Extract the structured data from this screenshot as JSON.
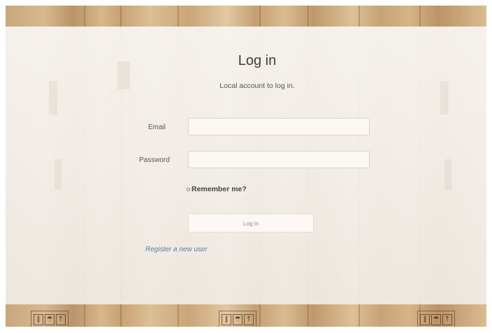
{
  "page": {
    "title": "Log in",
    "subtitle": "Local account to log in."
  },
  "form": {
    "email_label": "Email",
    "email_value": "",
    "password_label": "Password",
    "password_value": "",
    "remember_label": "Remember me?",
    "remember_checked": false,
    "submit_label": "Log in"
  },
  "links": {
    "register": "Register a new user"
  },
  "background": {
    "theme": "cardboard boxes",
    "handling_symbols": [
      "fragile-icon",
      "umbrella-icon",
      "this-side-up-icon"
    ]
  },
  "colors": {
    "link": "#4d7fae",
    "field_border": "#e3d2c3",
    "cardboard": "#c9a77e"
  }
}
